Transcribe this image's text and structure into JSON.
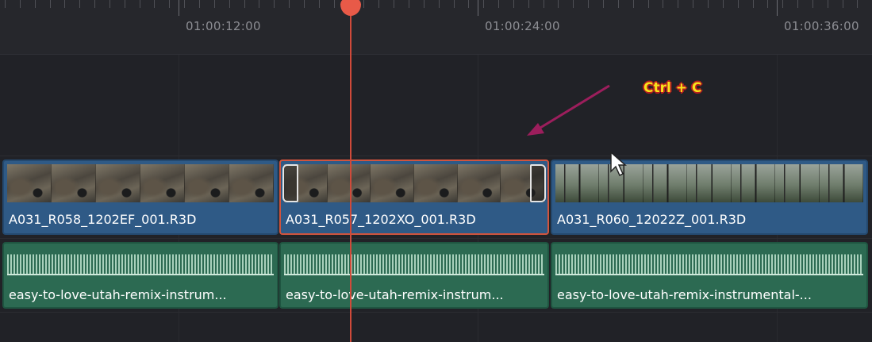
{
  "ruler": {
    "timecodes": [
      "01:00:12:00",
      "01:00:24:00",
      "01:00:36:00"
    ]
  },
  "video_track": {
    "clips": [
      {
        "name": "A031_R058_1202EF_001.R3D",
        "selected": false,
        "thumb": "rock"
      },
      {
        "name": "A031_R057_1202XO_001.R3D",
        "selected": true,
        "thumb": "rock"
      },
      {
        "name": "A031_R060_12022Z_001.R3D",
        "selected": false,
        "thumb": "forest"
      }
    ]
  },
  "audio_track": {
    "clips": [
      {
        "name": "easy-to-love-utah-remix-instrum..."
      },
      {
        "name": "easy-to-love-utah-remix-instrum..."
      },
      {
        "name": "easy-to-love-utah-remix-instrumental-..."
      }
    ]
  },
  "annotation": {
    "text": "Ctrl + C",
    "text_color": "#f7e21a",
    "outline_color": "#b61f1f",
    "arrow_color": "#9c1e5c",
    "arrow_icon": "annotation-arrow-icon"
  },
  "colors": {
    "video_clip": "#2f5a86",
    "audio_clip": "#2c6a52",
    "selection": "#d0543e",
    "playhead": "#d04a3a"
  },
  "cursor": "mouse-pointer-icon",
  "playhead_icon": "playhead-marker-icon"
}
